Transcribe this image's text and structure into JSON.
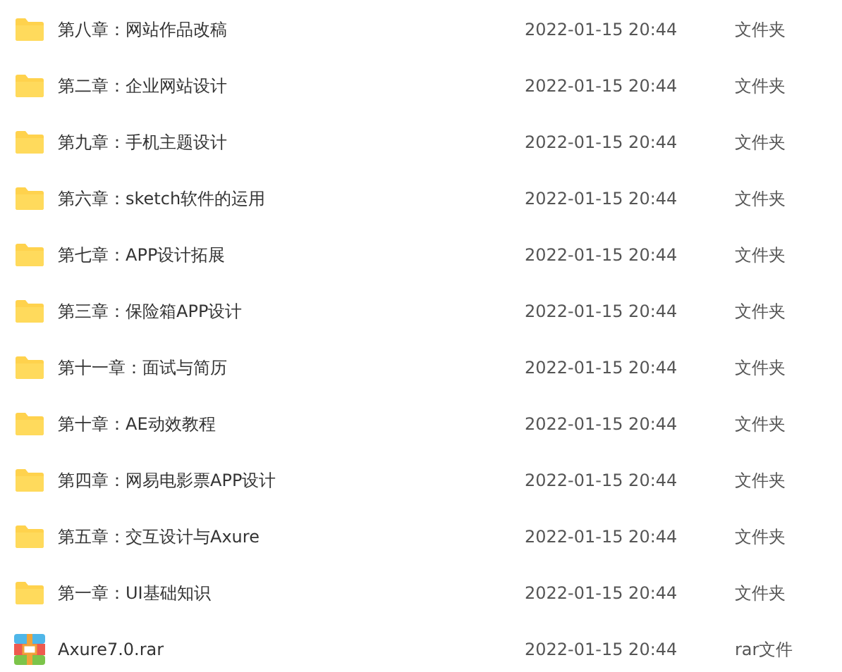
{
  "files": [
    {
      "kind": "folder",
      "name": "第八章：网站作品改稿",
      "modified": "2022-01-15 20:44",
      "type": "文件夹"
    },
    {
      "kind": "folder",
      "name": "第二章：企业网站设计",
      "modified": "2022-01-15 20:44",
      "type": "文件夹"
    },
    {
      "kind": "folder",
      "name": "第九章：手机主题设计",
      "modified": "2022-01-15 20:44",
      "type": "文件夹"
    },
    {
      "kind": "folder",
      "name": "第六章：sketch软件的运用",
      "modified": "2022-01-15 20:44",
      "type": "文件夹"
    },
    {
      "kind": "folder",
      "name": "第七章：APP设计拓展",
      "modified": "2022-01-15 20:44",
      "type": "文件夹"
    },
    {
      "kind": "folder",
      "name": "第三章：保险箱APP设计",
      "modified": "2022-01-15 20:44",
      "type": "文件夹"
    },
    {
      "kind": "folder",
      "name": "第十一章：面试与简历",
      "modified": "2022-01-15 20:44",
      "type": "文件夹"
    },
    {
      "kind": "folder",
      "name": "第十章：AE动效教程",
      "modified": "2022-01-15 20:44",
      "type": "文件夹"
    },
    {
      "kind": "folder",
      "name": "第四章：网易电影票APP设计",
      "modified": "2022-01-15 20:44",
      "type": "文件夹"
    },
    {
      "kind": "folder",
      "name": "第五章：交互设计与Axure",
      "modified": "2022-01-15 20:44",
      "type": "文件夹"
    },
    {
      "kind": "folder",
      "name": "第一章：UI基础知识",
      "modified": "2022-01-15 20:44",
      "type": "文件夹"
    },
    {
      "kind": "rar",
      "name": "Axure7.0.rar",
      "modified": "2022-01-15 20:44",
      "type": "rar文件"
    }
  ]
}
